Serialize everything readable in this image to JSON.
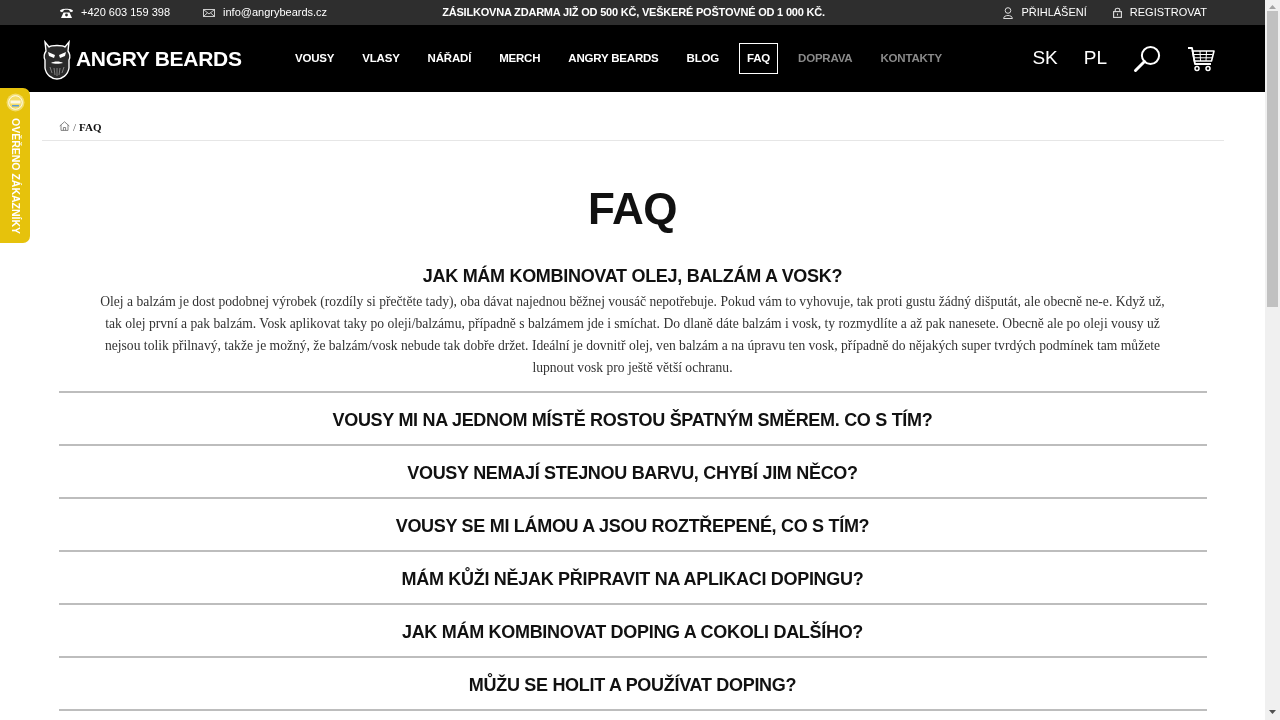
{
  "top_bar": {
    "phone": "+420 603 159 398",
    "email": "info@angrybeards.cz",
    "announcement": "ZÁSILKOVNA ZDARMA JIŽ OD 500 KČ, VEŠKERÉ POŠTOVNÉ OD 1 000 KČ.",
    "account_links": [
      {
        "kind": "login",
        "label": "PŘIHLÁŠENÍ"
      },
      {
        "kind": "register",
        "label": "REGISTROVAT"
      }
    ]
  },
  "header": {
    "logo_text": "ANGRY BEARDS",
    "nav": [
      {
        "label": "VOUSY",
        "selected": false,
        "muted": false
      },
      {
        "label": "VLASY",
        "selected": false,
        "muted": false
      },
      {
        "label": "NÁŘADÍ",
        "selected": false,
        "muted": false
      },
      {
        "label": "MERCH",
        "selected": false,
        "muted": false
      },
      {
        "label": "ANGRY BEARDS",
        "selected": false,
        "muted": false
      },
      {
        "label": "BLOG",
        "selected": false,
        "muted": false
      },
      {
        "label": "FAQ",
        "selected": true,
        "muted": false
      },
      {
        "label": "DOPRAVA",
        "selected": false,
        "muted": true
      },
      {
        "label": "KONTAKTY",
        "selected": false,
        "muted": true
      }
    ],
    "languages": [
      "SK",
      "PL"
    ]
  },
  "side_tab": {
    "label": "OVĚŘENO ZÁKAZNÍKY"
  },
  "breadcrumb": {
    "separator": "/",
    "current": "FAQ"
  },
  "page_title": "FAQ",
  "faq": [
    {
      "question": "JAK MÁM KOMBINOVAT OLEJ, BALZÁM A VOSK?",
      "expanded": true,
      "answer": "Olej a balzám je dost podobnej výrobek (rozdíly si přečtěte tady), oba dávat najednou běžnej vousáč nepotřebuje. Pokud vám to vyhovuje, tak proti gustu žádný dišputát, ale obecně ne-e. Když už, tak olej první a pak balzám. Vosk aplikovat taky po oleji/balzámu, případně s balzámem jde i smíchat. Do dlaně dáte balzám i vosk, ty rozmydlíte a až pak nanesete. Obecně ale po oleji vousy už nejsou tolik přilnavý, takže je možný, že balzám/vosk nebude tak dobře držet. Ideální je dovnitř olej, ven balzám a na úpravu ten vosk, případně do nějakých super tvrdých podmínek tam můžete lupnout vosk pro ještě větší ochranu."
    },
    {
      "question": "VOUSY MI NA JEDNOM MÍSTĚ ROSTOU ŠPATNÝM SMĚREM. CO S TÍM?",
      "expanded": false
    },
    {
      "question": "VOUSY NEMAJÍ STEJNOU BARVU, CHYBÍ JIM NĚCO?",
      "expanded": false
    },
    {
      "question": "VOUSY SE MI LÁMOU A JSOU ROZTŘEPENÉ, CO S TÍM?",
      "expanded": false
    },
    {
      "question": "MÁM KŮŽI NĚJAK PŘIPRAVIT NA APLIKACI DOPINGU?",
      "expanded": false
    },
    {
      "question": "JAK MÁM KOMBINOVAT DOPING A COKOLI DALŠÍHO?",
      "expanded": false
    },
    {
      "question": "MŮŽU SE HOLIT A POUŽÍVAT DOPING?",
      "expanded": false
    }
  ]
}
